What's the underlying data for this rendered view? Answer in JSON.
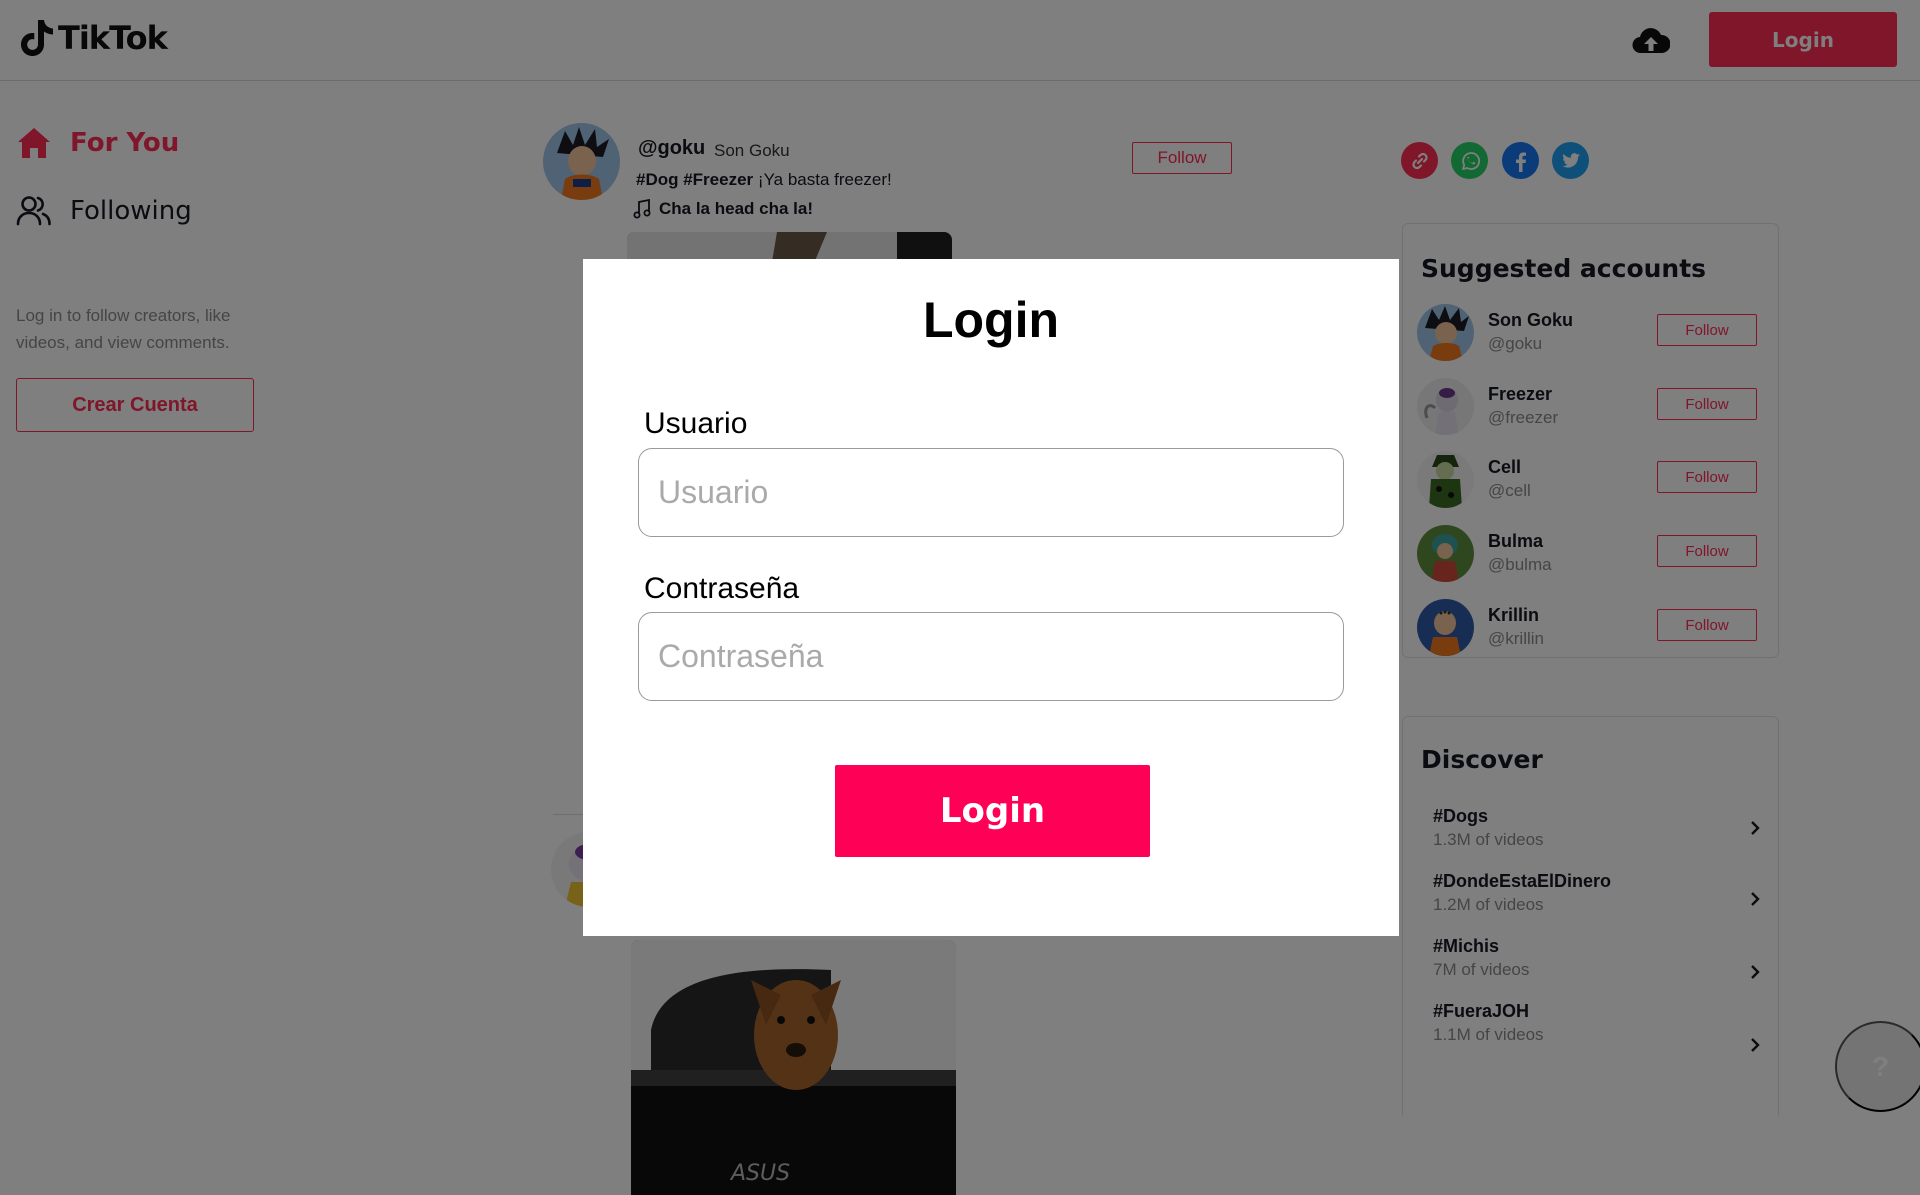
{
  "header": {
    "logo_text": "TikTok",
    "login_label": "Login",
    "upload_icon": "cloud-upload-icon"
  },
  "sidebar": {
    "items": [
      {
        "label": "For You",
        "icon": "home-icon",
        "active": true
      },
      {
        "label": "Following",
        "icon": "users-icon",
        "active": false
      }
    ],
    "login_hint": "Log in to follow creators, like videos, and view comments.",
    "create_account_label": "Crear Cuenta"
  },
  "feed": {
    "post": {
      "username": "@goku",
      "nickname": "Son Goku",
      "hashtags": "#Dog #Freezer",
      "caption": "¡Ya basta freezer!",
      "music": "Cha la head cha la!",
      "follow_label": "Follow"
    }
  },
  "share": {
    "icons": [
      "link-icon",
      "whatsapp-icon",
      "facebook-icon",
      "twitter-icon"
    ]
  },
  "suggested": {
    "title": "Suggested accounts",
    "accounts": [
      {
        "name": "Son Goku",
        "handle": "@goku",
        "follow_label": "Follow"
      },
      {
        "name": "Freezer",
        "handle": "@freezer",
        "follow_label": "Follow"
      },
      {
        "name": "Cell",
        "handle": "@cell",
        "follow_label": "Follow"
      },
      {
        "name": "Bulma",
        "handle": "@bulma",
        "follow_label": "Follow"
      },
      {
        "name": "Krillin",
        "handle": "@krillin",
        "follow_label": "Follow"
      }
    ]
  },
  "discover": {
    "title": "Discover",
    "topics": [
      {
        "tag": "#Dogs",
        "count": "1.3M of videos"
      },
      {
        "tag": "#DondeEstaElDinero",
        "count": "1.2M of videos"
      },
      {
        "tag": "#Michis",
        "count": "7M of videos"
      },
      {
        "tag": "#FueraJOH",
        "count": "1.1M of videos"
      }
    ]
  },
  "help": {
    "label": "?"
  },
  "modal": {
    "title": "Login",
    "user_label": "Usuario",
    "user_placeholder": "Usuario",
    "user_value": "",
    "password_label": "Contraseña",
    "password_placeholder": "Contraseña",
    "password_value": "",
    "submit_label": "Login"
  },
  "colors": {
    "brand": "#fe2c55",
    "modal_button": "#fe0055",
    "overlay": "rgba(0,0,0,0.5)"
  }
}
